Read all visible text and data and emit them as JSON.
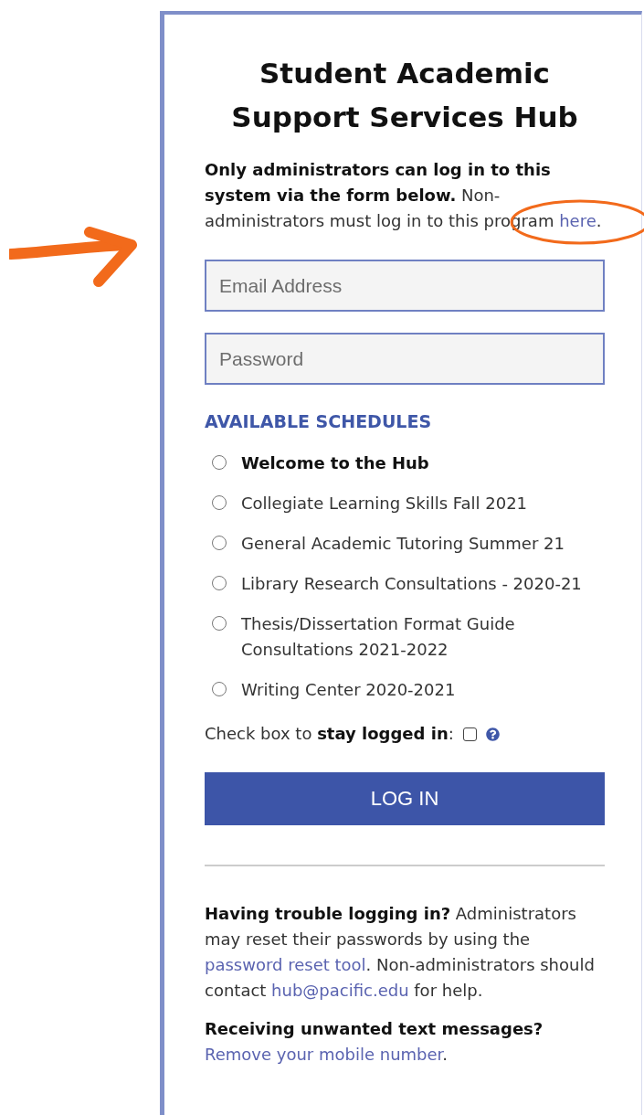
{
  "title": "Student Academic Support Services Hub",
  "intro": [
    {
      "kind": "bold",
      "text": "Only administrators can log in to this system via the form below."
    },
    {
      "kind": "plain",
      "text": " Non-administrators must log in to this program "
    },
    {
      "kind": "link",
      "text": "here",
      "circled": true
    },
    {
      "kind": "plain",
      "text": "."
    }
  ],
  "email": {
    "placeholder": "Email Address"
  },
  "password": {
    "placeholder": "Password"
  },
  "schedules_heading": "AVAILABLE SCHEDULES",
  "schedules": [
    {
      "label": "Welcome to the Hub",
      "kind": "featured",
      "selected": false
    },
    {
      "label": "Collegiate Learning Skills Fall 2021",
      "kind": "regular",
      "selected": false
    },
    {
      "label": "General Academic Tutoring Summer 21",
      "kind": "regular",
      "selected": false
    },
    {
      "label": "Library Research Consultations - 2020-21",
      "kind": "regular",
      "selected": false
    },
    {
      "label": "Thesis/Dissertation Format Guide Consultations 2021-2022",
      "kind": "regular",
      "selected": false
    },
    {
      "label": "Writing Center 2020-2021",
      "kind": "regular",
      "selected": false
    }
  ],
  "stay_logged_in": {
    "segments": [
      {
        "kind": "plain",
        "text": "Check box to "
      },
      {
        "kind": "bold",
        "text": "stay logged in"
      },
      {
        "kind": "plain",
        "text": ":"
      }
    ],
    "checked": false
  },
  "login_button": "LOG IN",
  "trouble": [
    {
      "kind": "bold",
      "text": "Having trouble logging in?"
    },
    {
      "kind": "plain",
      "text": " Administrators may reset their passwords by using the "
    },
    {
      "kind": "link",
      "text": "password reset tool"
    },
    {
      "kind": "plain",
      "text": ". Non-administrators should contact "
    },
    {
      "kind": "link",
      "text": "hub@pacific.edu"
    },
    {
      "kind": "plain",
      "text": " for help."
    }
  ],
  "unwanted": [
    {
      "kind": "bold",
      "text": "Receiving unwanted text messages?"
    },
    {
      "kind": "newline"
    },
    {
      "kind": "link",
      "text": "Remove your mobile number"
    },
    {
      "kind": "plain",
      "text": "."
    }
  ]
}
